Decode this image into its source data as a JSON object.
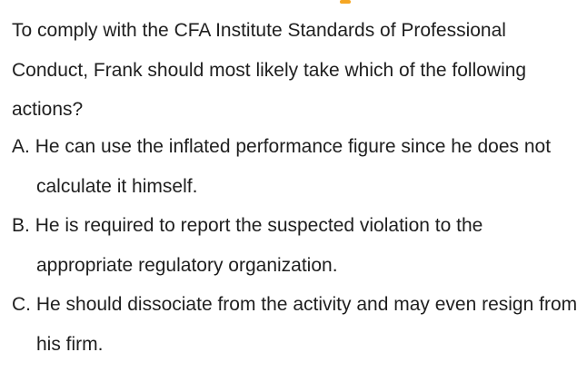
{
  "question": {
    "text": "To comply with the CFA Institute Standards of Professional Conduct,  Frank should most likely take which of the following actions?"
  },
  "options": [
    {
      "letter": "A.",
      "text": "He can use the inflated performance figure since he does not calculate it himself."
    },
    {
      "letter": "B.",
      "text": "He is required to report the suspected violation to the appropriate regulatory organization."
    },
    {
      "letter": "C.",
      "text": "He should dissociate from the activity and may even resign from his firm."
    }
  ],
  "colors": {
    "text": "#1f1f1f",
    "accent": "#f5a623",
    "background": "#ffffff"
  }
}
